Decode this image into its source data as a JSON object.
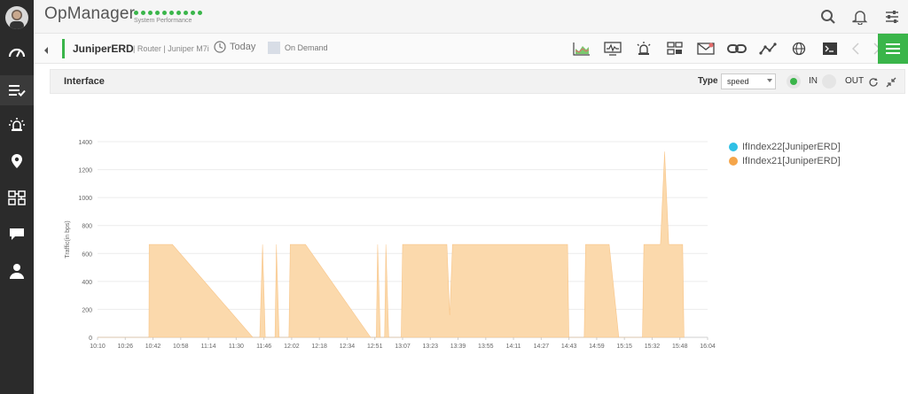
{
  "app": {
    "brand": "OpManager",
    "subtitle": "System Performance"
  },
  "sidebar": {
    "items": [
      {
        "icon": "dashboard-icon"
      },
      {
        "icon": "inventory-icon"
      },
      {
        "icon": "alarm-icon"
      },
      {
        "icon": "map-pin-icon"
      },
      {
        "icon": "network-icon"
      },
      {
        "icon": "chat-icon"
      },
      {
        "icon": "user-icon"
      }
    ]
  },
  "topbar_icons": [
    "search-icon",
    "bell-icon",
    "settings-sliders-icon"
  ],
  "device": {
    "name": "JuniperERD",
    "meta": "| Router | Juniper M7i",
    "period": "Today",
    "on_demand": "On Demand"
  },
  "device_toolbar_icons": [
    "chart-icon",
    "monitor-icon",
    "alarm-icon",
    "config-icon",
    "mail-icon",
    "link-icon",
    "graph-icon",
    "globe-icon",
    "terminal-icon",
    "chevron-left-icon",
    "chevron-right-icon"
  ],
  "panel": {
    "title": "Interface",
    "type_label": "Type",
    "type_value": "speed",
    "in_label": "IN",
    "out_label": "OUT"
  },
  "colors": {
    "accent": "#3ab54a",
    "series_in": "#2ec0e6",
    "series_out": "#f5a54a",
    "area_fill": "#fbd9ac"
  },
  "chart_data": {
    "type": "area",
    "ylabel": "Traffic(in bps)",
    "ylim": [
      0,
      1400
    ],
    "yticks": [
      0,
      200,
      400,
      600,
      800,
      1000,
      1200,
      1400
    ],
    "xticks": [
      "10:10",
      "10:26",
      "10:42",
      "10:58",
      "11:14",
      "11:30",
      "11:46",
      "12:02",
      "12:18",
      "12:34",
      "12:51",
      "13:07",
      "13:23",
      "13:39",
      "13:55",
      "14:11",
      "14:27",
      "14:43",
      "14:59",
      "15:15",
      "15:32",
      "15:48",
      "16:04"
    ],
    "legend": [
      "IfIndex22[JuniperERD]",
      "IfIndex21[JuniperERD]"
    ],
    "series": [
      {
        "name": "IfIndex22[JuniperERD]",
        "points": []
      },
      {
        "name": "IfIndex21[JuniperERD]",
        "points": [
          [
            0.0,
            0
          ],
          [
            1.85,
            0
          ],
          [
            1.86,
            665
          ],
          [
            2.7,
            665
          ],
          [
            5.6,
            0
          ],
          [
            5.85,
            0
          ],
          [
            5.95,
            665
          ],
          [
            6.05,
            0
          ],
          [
            6.4,
            0
          ],
          [
            6.45,
            665
          ],
          [
            6.55,
            0
          ],
          [
            6.9,
            0
          ],
          [
            6.95,
            665
          ],
          [
            7.5,
            665
          ],
          [
            9.85,
            0
          ],
          [
            10.05,
            0
          ],
          [
            10.1,
            665
          ],
          [
            10.2,
            0
          ],
          [
            10.35,
            0
          ],
          [
            10.4,
            665
          ],
          [
            10.5,
            0
          ],
          [
            10.95,
            0
          ],
          [
            11.0,
            665
          ],
          [
            12.6,
            665
          ],
          [
            12.7,
            160
          ],
          [
            12.8,
            665
          ],
          [
            16.95,
            665
          ],
          [
            17.0,
            0
          ],
          [
            17.55,
            0
          ],
          [
            17.6,
            665
          ],
          [
            18.45,
            665
          ],
          [
            18.8,
            0
          ],
          [
            19.65,
            0
          ],
          [
            19.7,
            665
          ],
          [
            20.3,
            665
          ],
          [
            20.45,
            1330
          ],
          [
            20.6,
            665
          ],
          [
            21.1,
            665
          ],
          [
            21.15,
            0
          ]
        ]
      }
    ]
  }
}
